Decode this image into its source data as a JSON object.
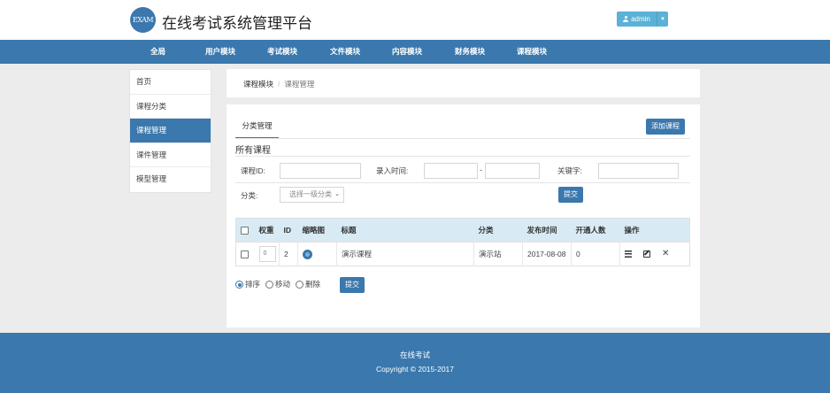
{
  "header": {
    "logo_text": "EXAM",
    "title": "在线考试系统管理平台",
    "admin_label": "admin"
  },
  "nav": {
    "items": [
      "全局",
      "用户模块",
      "考试模块",
      "文件模块",
      "内容模块",
      "财务模块",
      "课程模块"
    ],
    "active": "课程模块"
  },
  "sidebar": {
    "items": [
      "首页",
      "课程分类",
      "课程管理",
      "课件管理",
      "模型管理"
    ],
    "active": "课程管理"
  },
  "breadcrumb": {
    "parent": "课程模块",
    "separator": "/",
    "current": "课程管理"
  },
  "main": {
    "tab": "分类管理",
    "add_button": "添加课程",
    "section_title": "所有课程",
    "filters": {
      "course_id_label": "课程ID:",
      "course_id_value": "",
      "time_label": "录入时间:",
      "time_from": "",
      "time_dash": "-",
      "time_to": "",
      "keyword_label": "关键字:",
      "keyword_value": "",
      "category_label": "分类:",
      "category_selected": "选择一级分类",
      "submit": "提交"
    },
    "table": {
      "headers": [
        "权重",
        "ID",
        "缩略图",
        "标题",
        "分类",
        "发布时间",
        "开通人数",
        "操作"
      ],
      "rows": [
        {
          "weight": "0",
          "id": "2",
          "title": "演示课程",
          "category": "演示站",
          "date": "2017-08-08",
          "count": "0"
        }
      ]
    },
    "actions": {
      "options": [
        "排序",
        "移动",
        "删除"
      ],
      "selected": "排序",
      "submit": "提交"
    }
  },
  "footer": {
    "line1": "在线考试",
    "line2": "Copyright © 2015-2017"
  },
  "colors": {
    "primary": "#3a78ad",
    "table_header": "#d8ebf4",
    "admin_button": "#5bb1d6"
  }
}
